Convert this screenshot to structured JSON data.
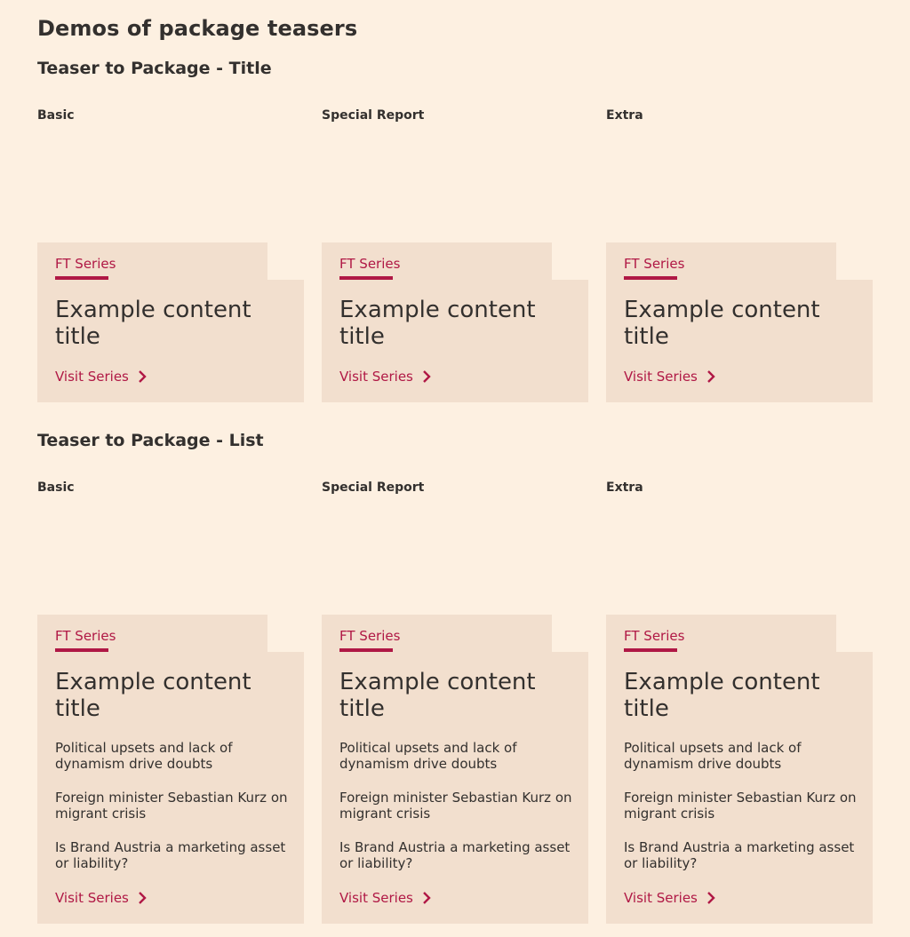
{
  "page_title": "Demos of package teasers",
  "sections": [
    {
      "heading": "Teaser to Package - Title",
      "columns": [
        {
          "label": "Basic",
          "tag": "FT Series",
          "title": "Example content title",
          "cta": "Visit Series"
        },
        {
          "label": "Special Report",
          "tag": "FT Series",
          "title": "Example content title",
          "cta": "Visit Series"
        },
        {
          "label": "Extra",
          "tag": "FT Series",
          "title": "Example content title",
          "cta": "Visit Series"
        }
      ]
    },
    {
      "heading": "Teaser to Package - List",
      "columns": [
        {
          "label": "Basic",
          "tag": "FT Series",
          "title": "Example content title",
          "links": [
            "Political upsets and lack of dynamism drive doubts",
            "Foreign minister Sebastian Kurz on migrant crisis",
            "Is Brand Austria a marketing asset or liability?"
          ],
          "cta": "Visit Series"
        },
        {
          "label": "Special Report",
          "tag": "FT Series",
          "title": "Example content title",
          "links": [
            "Political upsets and lack of dynamism drive doubts",
            "Foreign minister Sebastian Kurz on migrant crisis",
            "Is Brand Austria a marketing asset or liability?"
          ],
          "cta": "Visit Series"
        },
        {
          "label": "Extra",
          "tag": "FT Series",
          "title": "Example content title",
          "links": [
            "Political upsets and lack of dynamism drive doubts",
            "Foreign minister Sebastian Kurz on migrant crisis",
            "Is Brand Austria a marketing asset or liability?"
          ],
          "cta": "Visit Series"
        }
      ]
    }
  ],
  "icons": {
    "cta": "chevron-right-icon"
  },
  "colors": {
    "background": "#fdf0e1",
    "card": "#f2dfce",
    "accent": "#b01845",
    "text": "#33302e"
  }
}
